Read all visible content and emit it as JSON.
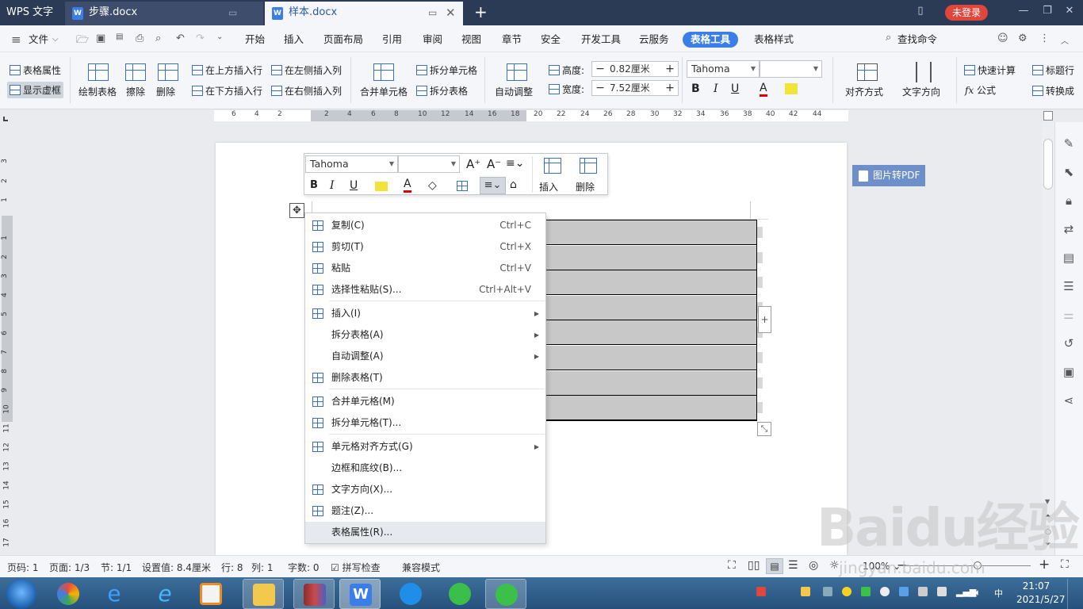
{
  "titlebar": {
    "app": "WPS 文字",
    "tabs": [
      {
        "label": "步骤.docx"
      },
      {
        "label": "样本.docx"
      }
    ],
    "login": "未登录"
  },
  "menubar": {
    "file": "文件",
    "items": [
      "开始",
      "插入",
      "页面布局",
      "引用",
      "审阅",
      "视图",
      "章节",
      "安全",
      "开发工具",
      "云服务",
      "表格工具",
      "表格样式"
    ],
    "active": "表格工具",
    "search": "查找命令"
  },
  "ribbon": {
    "table_props": "表格属性",
    "show_gridlines": "显示虚框",
    "draw_table": "绘制表格",
    "erase": "擦除",
    "delete": "删除",
    "insert_above": "在上方插入行",
    "insert_below": "在下方插入行",
    "insert_left": "在左侧插入列",
    "insert_right": "在右侧插入列",
    "merge_cells": "合并单元格",
    "split_cells": "拆分单元格",
    "split_table": "拆分表格",
    "autofit": "自动调整",
    "height_label": "高度:",
    "height_value": "0.82厘米",
    "width_label": "宽度:",
    "width_value": "7.52厘米",
    "font_name": "Tahoma",
    "align": "对齐方式",
    "text_direction": "文字方向",
    "quick_calc": "快速计算",
    "formula": "公式",
    "title_row": "标题行",
    "convert": "转换成"
  },
  "ruler": {
    "h_numbers": [
      "6",
      "4",
      "2",
      "2",
      "4",
      "6",
      "8",
      "10",
      "12",
      "14",
      "16",
      "18",
      "20",
      "22",
      "24",
      "26",
      "28",
      "30",
      "32",
      "34",
      "36",
      "38",
      "40",
      "42",
      "44"
    ],
    "v_numbers": [
      "3",
      "2",
      "1",
      "1",
      "2",
      "3",
      "4",
      "5",
      "6",
      "7",
      "8",
      "9",
      "10",
      "11",
      "12",
      "13",
      "14",
      "15",
      "16",
      "17"
    ]
  },
  "minibar": {
    "font": "Tahoma",
    "insert": "插入",
    "delete": "删除"
  },
  "pdf_button": "图片转PDF",
  "context_menu": [
    {
      "label": "复制(C)",
      "shortcut": "Ctrl+C",
      "icon": "copy-icon"
    },
    {
      "label": "剪切(T)",
      "shortcut": "Ctrl+X",
      "icon": "scissors-icon"
    },
    {
      "label": "粘贴",
      "shortcut": "Ctrl+V",
      "icon": "paste-icon"
    },
    {
      "label": "选择性粘贴(S)...",
      "shortcut": "Ctrl+Alt+V",
      "icon": "paste-special-icon"
    },
    {
      "label": "插入(I)",
      "shortcut": "",
      "icon": "table-insert-icon",
      "submenu": true
    },
    {
      "label": "拆分表格(A)",
      "shortcut": "",
      "icon": "",
      "submenu": true
    },
    {
      "label": "自动调整(A)",
      "shortcut": "",
      "icon": "",
      "submenu": true
    },
    {
      "label": "删除表格(T)",
      "shortcut": "",
      "icon": "table-delete-icon"
    },
    {
      "label": "合并单元格(M)",
      "shortcut": "",
      "icon": "merge-cells-icon"
    },
    {
      "label": "拆分单元格(T)...",
      "shortcut": "",
      "icon": "split-cells-icon"
    },
    {
      "label": "单元格对齐方式(G)",
      "shortcut": "",
      "icon": "cell-align-icon",
      "submenu": true
    },
    {
      "label": "边框和底纹(B)...",
      "shortcut": "",
      "icon": ""
    },
    {
      "label": "文字方向(X)...",
      "shortcut": "",
      "icon": "text-direction-icon"
    },
    {
      "label": "题注(Z)...",
      "shortcut": "",
      "icon": "caption-icon"
    },
    {
      "label": "表格属性(R)...",
      "shortcut": "",
      "icon": "",
      "highlighted": true
    }
  ],
  "status": {
    "page_num": "页码: 1",
    "page_count": "页面: 1/3",
    "section": "节: 1/1",
    "setting": "设置值: 8.4厘米",
    "row": "行: 8",
    "col": "列: 1",
    "words": "字数: 0",
    "spellcheck": "拼写检查",
    "compat": "兼容模式",
    "zoom": "100%"
  },
  "taskbar": {
    "time": "21:07",
    "date": "2021/5/27"
  },
  "watermark": {
    "brand": "Baidu经验",
    "url": "jingyan.baidu.com"
  },
  "colors": {
    "accent": "#3b7de9",
    "titlebar": "#2b3a55",
    "login": "#e0463c",
    "cell_shade": "#c8c8c8"
  }
}
